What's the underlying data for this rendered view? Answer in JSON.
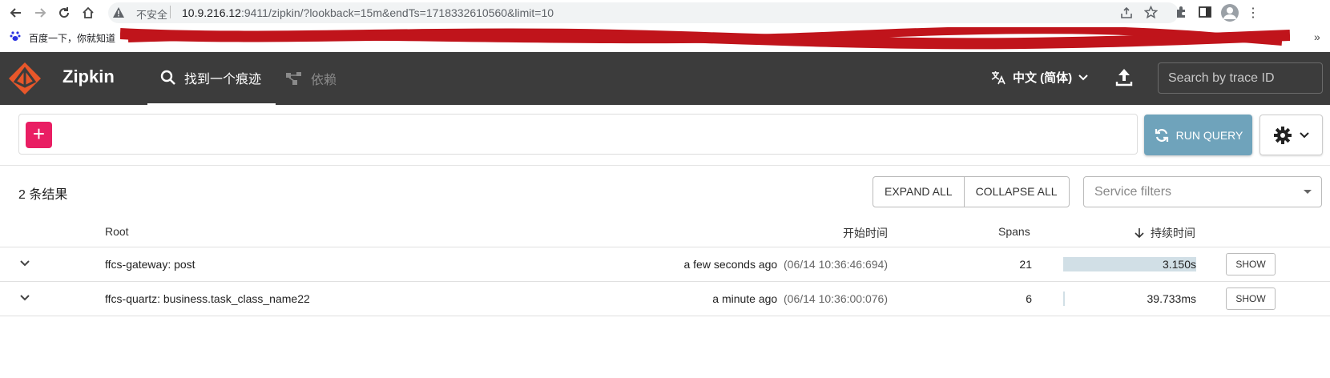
{
  "browser": {
    "security_label": "不安全",
    "url_host": "10.9.216.12",
    "url_rest": ":9411/zipkin/?lookback=15m&endTs=1718332610560&limit=10",
    "bookmark_label": "百度一下，你就知道",
    "overflow_label": "»"
  },
  "header": {
    "brand": "Zipkin",
    "tabs": [
      {
        "label": "找到一个痕迹",
        "active": true
      },
      {
        "label": "依赖",
        "active": false
      }
    ],
    "language": "中文 (简体)",
    "search_placeholder": "Search by trace ID"
  },
  "query": {
    "add_label": "+",
    "run_label": "RUN QUERY"
  },
  "results": {
    "count_text": "2 条结果",
    "expand_all": "EXPAND ALL",
    "collapse_all": "COLLAPSE ALL",
    "service_filters_placeholder": "Service filters",
    "columns": {
      "root": "Root",
      "start_time": "开始时间",
      "spans": "Spans",
      "duration": "持续时间"
    },
    "rows": [
      {
        "root": "ffcs-gateway: post",
        "relative_time": "a few seconds ago",
        "timestamp": "(06/14 10:36:46:694)",
        "spans": "21",
        "duration": "3.150s",
        "duration_fraction": 1.0,
        "action": "SHOW"
      },
      {
        "root": "ffcs-quartz: business.task_class_name22",
        "relative_time": "a minute ago",
        "timestamp": "(06/14 10:36:00:076)",
        "spans": "6",
        "duration": "39.733ms",
        "duration_fraction": 0.0126,
        "action": "SHOW"
      }
    ]
  },
  "colors": {
    "header_bg": "#3c3c3c",
    "add_button": "#e91e63",
    "run_button": "#6fa3bb",
    "duration_bar": "#d1dfe6",
    "logo": "#e8572a"
  }
}
